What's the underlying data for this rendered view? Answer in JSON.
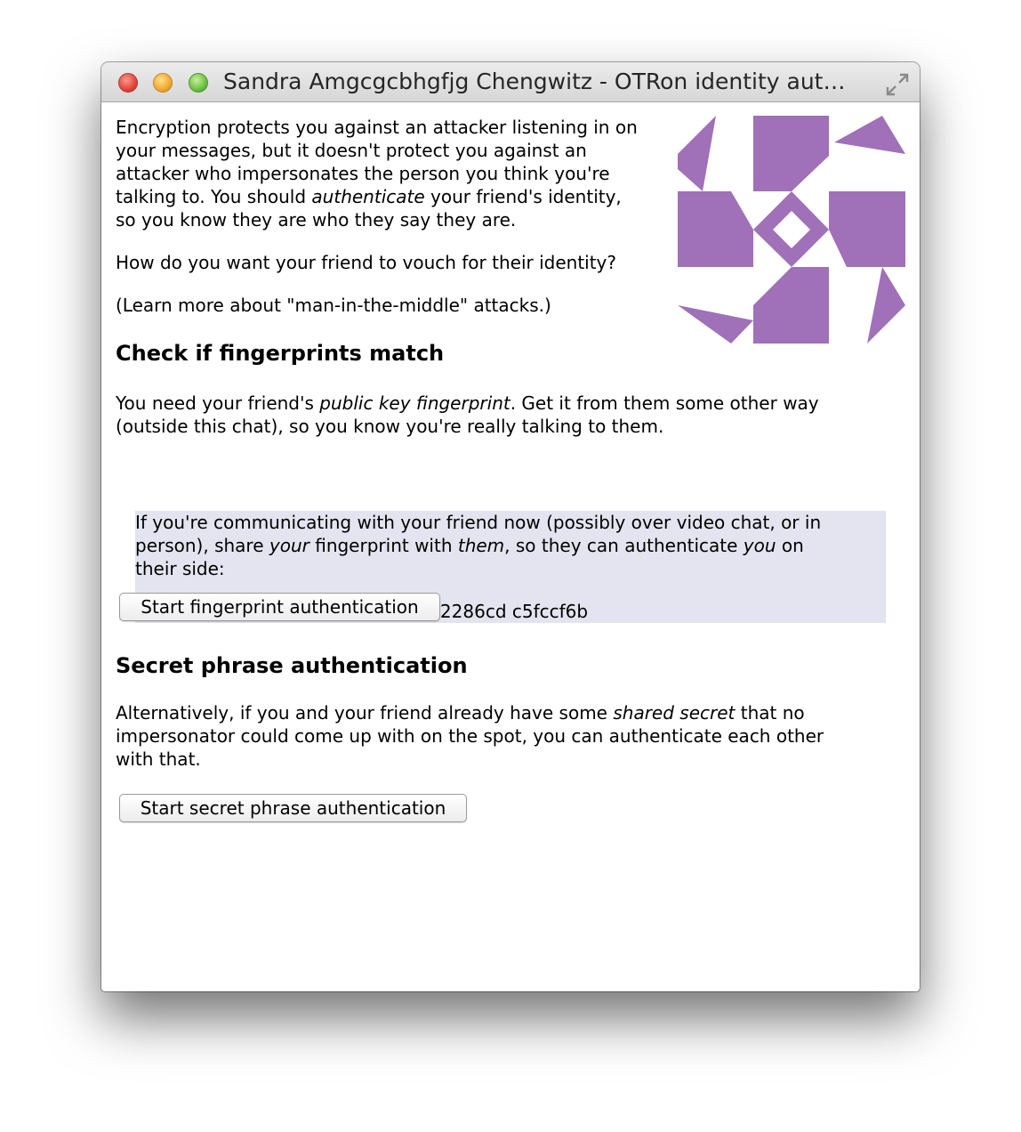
{
  "window": {
    "title": "Sandra Amgcgcbhgfjg Chengwitz - OTRon identity aut…"
  },
  "intro": {
    "para1_a": "Encryption protects you against an attacker listening in on",
    "para1_b": "your messages, but it doesn't protect you against an",
    "para1_c": "attacker who impersonates the person you think you're",
    "para1_d_pre": "talking to. You should ",
    "para1_d_em": "authenticate",
    "para1_d_post": " your friend's identity,",
    "para1_e": "so you know they are who they say they are.",
    "question": "How do you want your friend to vouch for their identity?",
    "learn_more": "(Learn more about \"man-in-the-middle\" attacks.)"
  },
  "avatar": {
    "icon": "identicon-avatar",
    "color": "#a070b8"
  },
  "fingerprint_section": {
    "heading": "Check if fingerprints match",
    "desc_pre": "You need your friend's ",
    "desc_em": "public key fingerprint",
    "desc_post": ". Get it from them some other way",
    "desc_line2": "(outside this chat), so you know you're really talking to them.",
    "box_line1": "If you're communicating with your friend now (possibly over video chat, or in",
    "box_line2_a": "person), share ",
    "box_line2_em1": "your",
    "box_line2_b": " fingerprint with ",
    "box_line2_em2": "them",
    "box_line2_c": ", so they can authenticate ",
    "box_line2_em3": "you",
    "box_line2_d": " on",
    "box_line3": "their side:",
    "fingerprint": "9e52355d 643965aa c31cc0e5 752286cd c5fccf6b",
    "button_label": "Start fingerprint authentication"
  },
  "secret_section": {
    "heading": "Secret phrase authentication",
    "desc_pre": "Alternatively, if you and your friend already have some ",
    "desc_em": "shared secret",
    "desc_post": " that no",
    "desc_line2": "impersonator could come up with on the spot, you can authenticate each other",
    "desc_line3": "with that.",
    "button_label": "Start secret phrase authentication"
  }
}
